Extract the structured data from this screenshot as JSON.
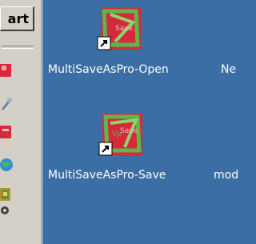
{
  "taskbar": {
    "start_label": "art",
    "quick_launch": [
      {
        "icon": "app-red-icon"
      },
      {
        "icon": "tool-icon"
      },
      {
        "icon": "app-red-icon-2"
      },
      {
        "icon": "globe-icon"
      },
      {
        "icon": "archive-icon"
      },
      {
        "icon": "gear-icon"
      }
    ]
  },
  "desktop": {
    "icons": [
      {
        "label": "MultiSaveAsPro-Open"
      },
      {
        "label": "Ne"
      },
      {
        "label": "MultiSaveAsPro-Save"
      },
      {
        "label": "mod"
      }
    ]
  },
  "colors": {
    "desktop_bg": "#3a6ea5",
    "taskbar_bg": "#d4d0c8",
    "icon_red": "#d8283c",
    "icon_green": "#5cb84e"
  }
}
